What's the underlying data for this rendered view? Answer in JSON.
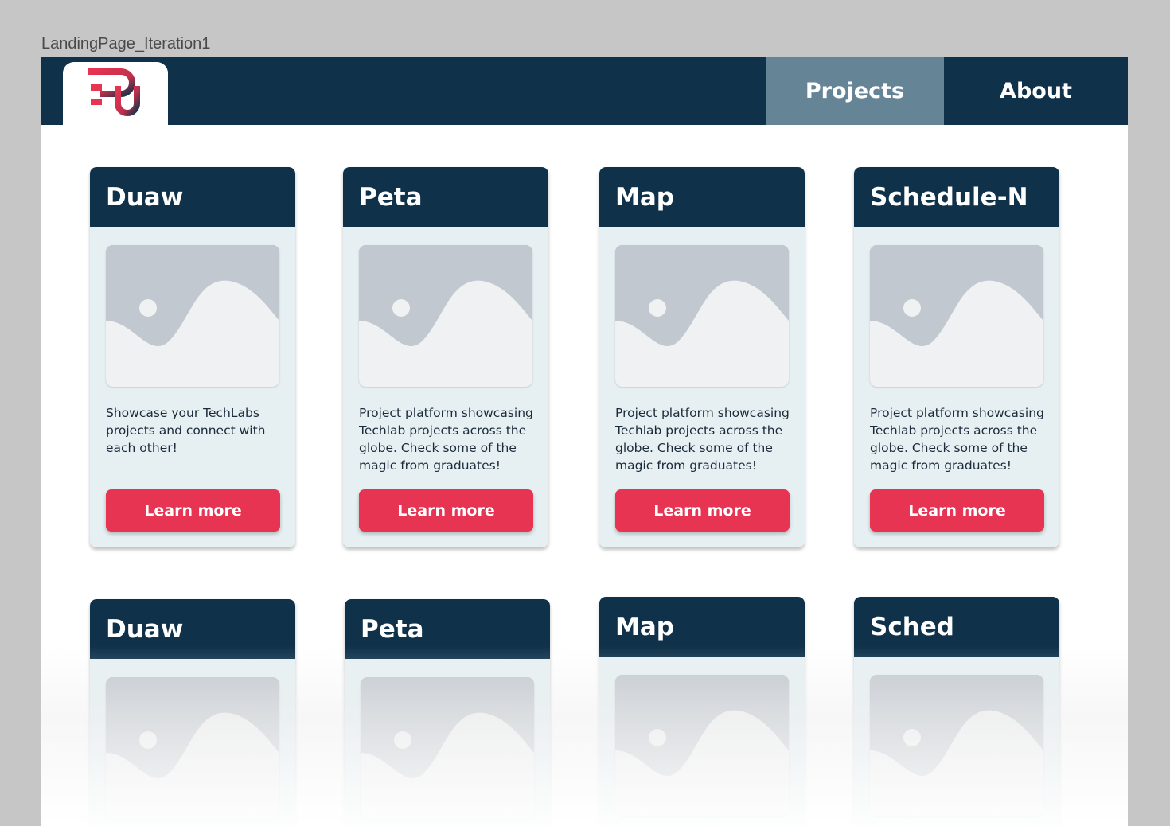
{
  "canvas": {
    "frame_label": "LandingPage_Iteration1"
  },
  "header": {
    "logo_icon": "pu-logo-icon",
    "nav": [
      {
        "label": "Projects",
        "active": true
      },
      {
        "label": "About",
        "active": false
      }
    ]
  },
  "colors": {
    "navy": "#0f324a",
    "active_nav": "#658597",
    "accent": "#e63452",
    "card_bg": "#e6f0f3"
  },
  "projects_row1": [
    {
      "title": "Duaw",
      "image_icon": "image-placeholder-icon",
      "description": "Showcase your TechLabs projects and connect with each other!",
      "button": "Learn more"
    },
    {
      "title": "Peta",
      "image_icon": "image-placeholder-icon",
      "description": "Project platform showcasing Techlab projects across the globe. Check some of the magic from graduates!",
      "button": "Learn more"
    },
    {
      "title": "Map",
      "image_icon": "image-placeholder-icon",
      "description": "Project platform showcasing Techlab projects across the globe. Check some of the magic from graduates!",
      "button": "Learn more"
    },
    {
      "title": "Schedule-N",
      "image_icon": "image-placeholder-icon",
      "description": "Project platform showcasing Techlab projects across the globe. Check some of the magic from graduates!",
      "button": "Learn more"
    }
  ],
  "projects_row2": [
    {
      "title": "Duaw",
      "image_icon": "image-placeholder-icon"
    },
    {
      "title": "Peta",
      "image_icon": "image-placeholder-icon"
    },
    {
      "title": "Map",
      "image_icon": "image-placeholder-icon"
    },
    {
      "title": "Sched",
      "image_icon": "image-placeholder-icon"
    }
  ]
}
